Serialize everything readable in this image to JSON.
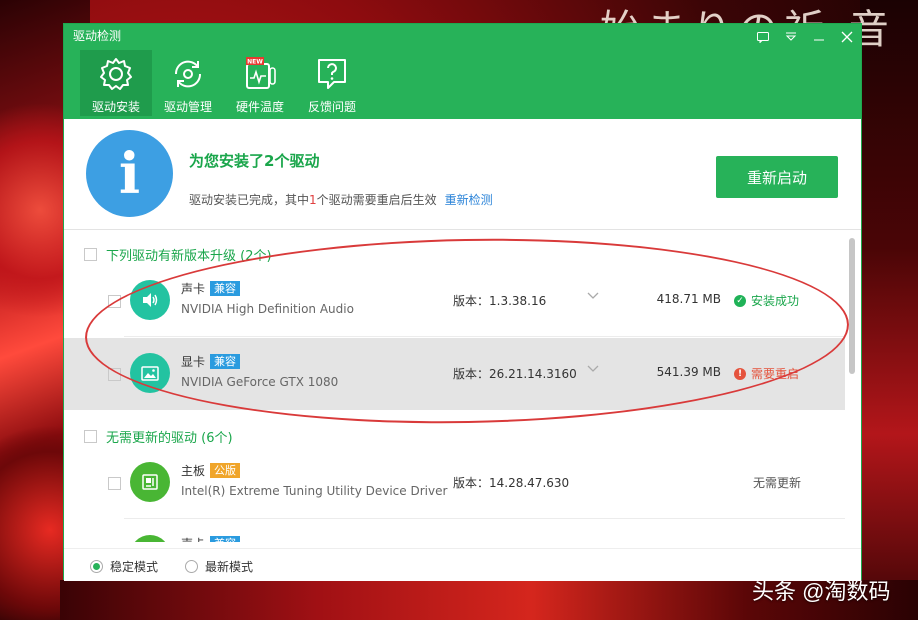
{
  "background": {
    "jp_text": "始まりの祈  音",
    "watermark": "头条 @淘数码"
  },
  "window": {
    "title": "驱动检测",
    "controls": [
      "feedback-icon",
      "menu-icon",
      "minimize-icon",
      "close-icon"
    ],
    "accent": "#27b259"
  },
  "tabs": [
    {
      "label": "驱动安装",
      "icon": "gear-icon",
      "active": true
    },
    {
      "label": "驱动管理",
      "icon": "refresh-icon",
      "active": false
    },
    {
      "label": "硬件温度",
      "icon": "thermometer-icon",
      "badge": "NEW",
      "active": false
    },
    {
      "label": "反馈问题",
      "icon": "question-icon",
      "active": false
    }
  ],
  "summary": {
    "title": "为您安装了2个驱动",
    "sub_pre": "驱动安装已完成，其中",
    "sub_count": "1",
    "sub_post": "个驱动需要重启后生效",
    "recheck_link": "重新检测",
    "restart_button": "重新启动",
    "info_icon": "i"
  },
  "upgrade_group": {
    "header": "下列驱动有新版本升级 (2个)",
    "items": [
      {
        "type": "声卡",
        "tag": "兼容",
        "name": "NVIDIA High Definition Audio",
        "version": "版本：1.3.38.16",
        "size": "418.71 MB",
        "status": "安装成功",
        "status_kind": "ok",
        "icon": "speaker-icon"
      },
      {
        "type": "显卡",
        "tag": "兼容",
        "name": "NVIDIA GeForce GTX 1080",
        "version": "版本：26.21.14.3160",
        "size": "541.39 MB",
        "status": "需要重启",
        "status_kind": "warn",
        "icon": "display-icon"
      }
    ]
  },
  "noupdate_group": {
    "header": "无需更新的驱动 (6个)",
    "items": [
      {
        "type": "主板",
        "tag": "公版",
        "name": "Intel(R) Extreme Tuning Utility Device Driver",
        "version": "版本：14.28.47.630",
        "status": "无需更新",
        "icon": "motherboard-icon"
      },
      {
        "type": "声卡",
        "tag": "兼容",
        "icon": "speaker-icon"
      }
    ]
  },
  "footer": {
    "stable_mode": "稳定模式",
    "latest_mode": "最新模式",
    "selected": "稳定模式"
  }
}
